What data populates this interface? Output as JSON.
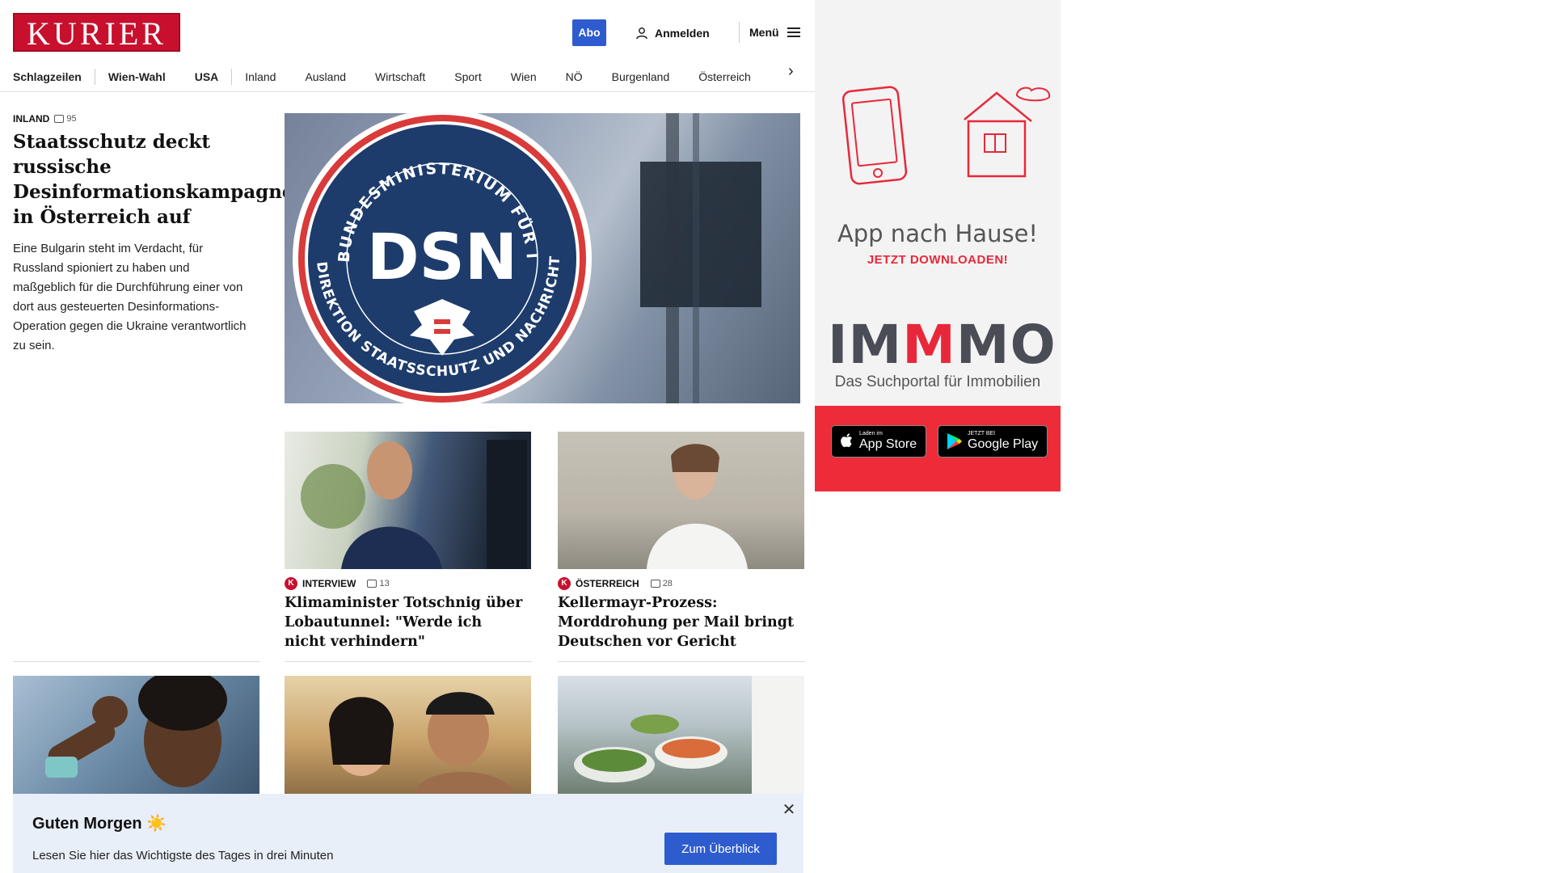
{
  "header": {
    "logo": "KURIER",
    "abo_label": "Abo",
    "login_label": "Anmelden",
    "menu_label": "Menü"
  },
  "nav": {
    "items": [
      "Schlagzeilen",
      "Wien-Wahl",
      "USA",
      "Inland",
      "Ausland",
      "Wirtschaft",
      "Sport",
      "Wien",
      "NÖ",
      "Burgenland",
      "Österreich"
    ]
  },
  "lead": {
    "category": "INLAND",
    "comments": "95",
    "title": "Staatsschutz deckt russische Desinformationskampagne in Österreich auf",
    "teaser": "Eine Bulgarin steht im Verdacht, für Russland spioniert zu haben und maßgeblich für die Durchführung einer von dort aus gesteuerten Desinformations-Operation gegen die Ukraine verantwortlich zu sein.",
    "image": {
      "seal_top": "BUNDESMINISTERIUM FÜR INNERES",
      "seal_bottom": "DIREKTION STAATSSCHUTZ UND NACHRICHTENDIENST",
      "seal_center": "DSN"
    }
  },
  "cards": [
    {
      "badge": "K",
      "category": "INTERVIEW",
      "comments": "13",
      "title": "Klimaminister Totschnig über Lobautunnel: \"Werde ich nicht verhindern\""
    },
    {
      "badge": "K",
      "category": "ÖSTERREICH",
      "comments": "28",
      "title": "Kellermayr-Prozess: Morddrohung per Mail bringt Deutschen vor Gericht"
    }
  ],
  "ad": {
    "headline": "App nach Hause!",
    "subline": "JETZT DOWNLOADEN!",
    "brand_parts": [
      "IM",
      "M",
      "MO"
    ],
    "tagline": "Das Suchportal für Immobilien",
    "appstore_small": "Laden im",
    "appstore_big": "App Store",
    "googleplay_small": "JETZT BEI",
    "googleplay_big": "Google Play",
    "colors": {
      "accent": "#ee2b38",
      "grey": "#4a4d55"
    }
  },
  "banner": {
    "title": "Guten Morgen ☀️",
    "text": "Lesen Sie hier das Wichtigste des Tages in drei Minuten",
    "button": "Zum Überblick"
  },
  "colors": {
    "brand": "#c8102e",
    "primary_button": "#2e5ccf"
  }
}
